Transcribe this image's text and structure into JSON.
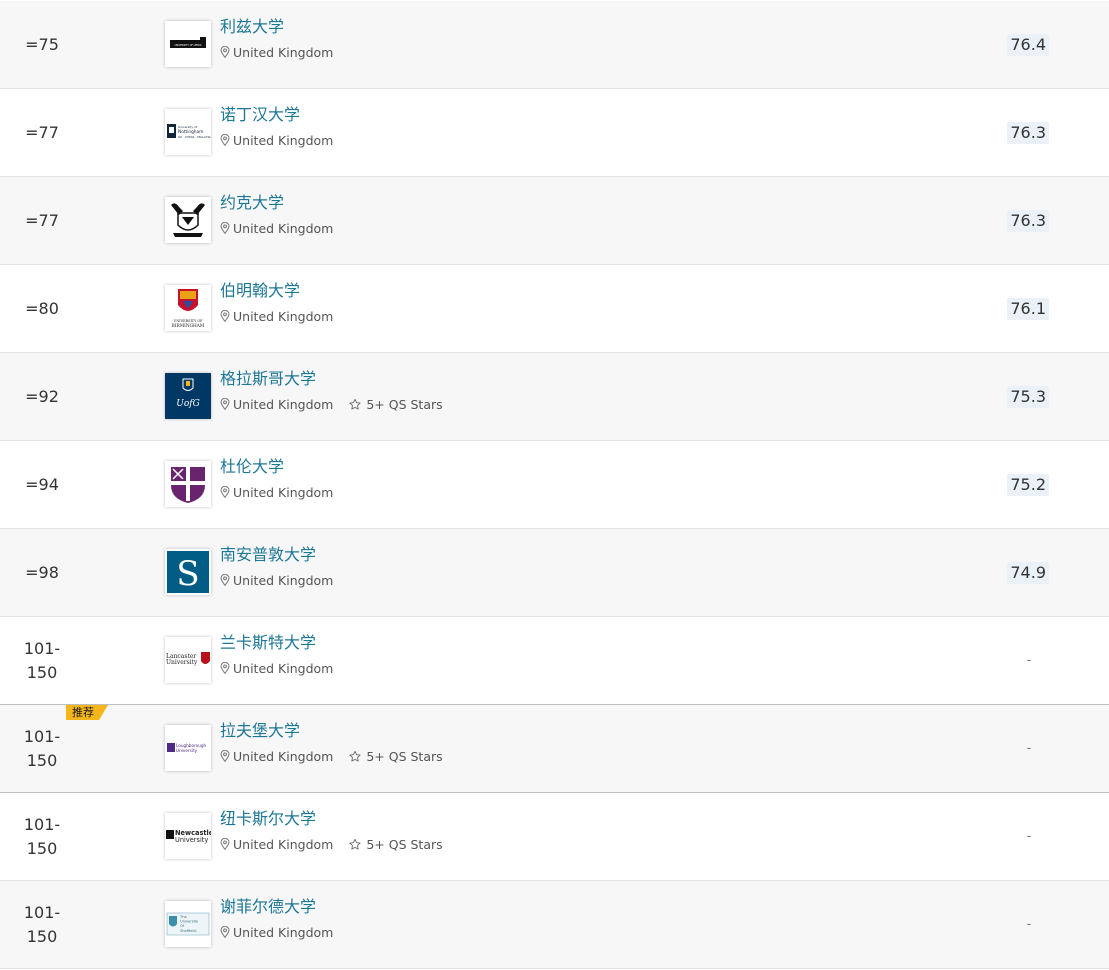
{
  "rows": [
    {
      "rank": "=75",
      "name": "利兹大学",
      "location": "United Kingdom",
      "stars": "",
      "score": "76.4",
      "logo": "leeds-logo"
    },
    {
      "rank": "=77",
      "name": "诺丁汉大学",
      "location": "United Kingdom",
      "stars": "",
      "score": "76.3",
      "logo": "nottingham-logo"
    },
    {
      "rank": "=77",
      "name": "约克大学",
      "location": "United Kingdom",
      "stars": "",
      "score": "76.3",
      "logo": "york-logo"
    },
    {
      "rank": "=80",
      "name": "伯明翰大学",
      "location": "United Kingdom",
      "stars": "",
      "score": "76.1",
      "logo": "birmingham-logo"
    },
    {
      "rank": "=92",
      "name": "格拉斯哥大学",
      "location": "United Kingdom",
      "stars": "5+ QS Stars",
      "score": "75.3",
      "logo": "glasgow-logo"
    },
    {
      "rank": "=94",
      "name": "杜伦大学",
      "location": "United Kingdom",
      "stars": "",
      "score": "75.2",
      "logo": "durham-logo"
    },
    {
      "rank": "=98",
      "name": "南安普敦大学",
      "location": "United Kingdom",
      "stars": "",
      "score": "74.9",
      "logo": "southampton-logo"
    },
    {
      "rank": "101-\n150",
      "name": "兰卡斯特大学",
      "location": "United Kingdom",
      "stars": "",
      "score": "-",
      "logo": "lancaster-logo"
    },
    {
      "rank": "101-\n150",
      "name": "拉夫堡大学",
      "location": "United Kingdom",
      "stars": "5+ QS Stars",
      "score": "-",
      "logo": "loughborough-logo",
      "badge": "推荐"
    },
    {
      "rank": "101-\n150",
      "name": "纽卡斯尔大学",
      "location": "United Kingdom",
      "stars": "5+ QS Stars",
      "score": "-",
      "logo": "newcastle-logo"
    },
    {
      "rank": "101-\n150",
      "name": "谢菲尔德大学",
      "location": "United Kingdom",
      "stars": "",
      "score": "-",
      "logo": "sheffield-logo"
    }
  ],
  "logo_text": {
    "leeds": "UNIVERSITY OF LEEDS",
    "nottingham": [
      "University of",
      "Nottingham",
      "UK · CHINA · MALAYSIA"
    ],
    "birmingham": [
      "UNIVERSITY OF",
      "BIRMINGHAM"
    ],
    "glasgow": "UofG",
    "southampton": "S",
    "lancaster": [
      "Lancaster",
      "University"
    ],
    "loughborough": [
      "Loughborough",
      "University"
    ],
    "newcastle": [
      "Newcastle",
      "University"
    ],
    "sheffield": [
      "The",
      "University",
      "Of",
      "Sheffield."
    ]
  },
  "colors": {
    "link": "#1d7796",
    "score_bg": "#eaf1f8",
    "badge": "#f4b61a",
    "glasgow_navy": "#003865",
    "durham_purple": "#68246d",
    "southampton_teal": "#005c84"
  }
}
